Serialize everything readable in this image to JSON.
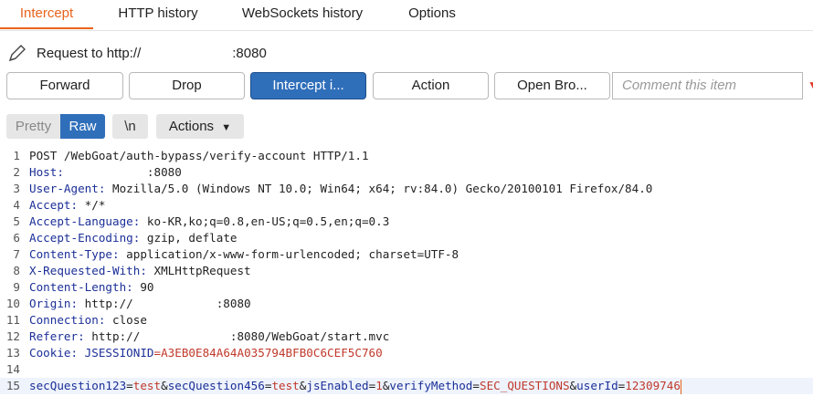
{
  "tabs": [
    "Intercept",
    "HTTP history",
    "WebSockets history",
    "Options"
  ],
  "request": {
    "prefix": "Request to http://",
    "suffix": ":8080"
  },
  "buttons": {
    "forward": "Forward",
    "drop": "Drop",
    "intercept": "Intercept i...",
    "action": "Action",
    "open_browser": "Open Bro..."
  },
  "comment_placeholder": "Comment this item",
  "view": {
    "pretty": "Pretty",
    "raw": "Raw",
    "newline": "\\n",
    "actions": "Actions"
  },
  "colors": {
    "accent": "#e8631c",
    "primary": "#2f6fba",
    "header_key": "#1b2f97",
    "value_red": "#c0392b"
  },
  "lines": [
    {
      "n": "1",
      "k": "",
      "v": "POST /WebGoat/auth-bypass/verify-account HTTP/1.1"
    },
    {
      "n": "2",
      "k": "Host:",
      "v": "            :8080"
    },
    {
      "n": "3",
      "k": "User-Agent:",
      "v": " Mozilla/5.0 (Windows NT 10.0; Win64; x64; rv:84.0) Gecko/20100101 Firefox/84.0"
    },
    {
      "n": "4",
      "k": "Accept:",
      "v": " */*"
    },
    {
      "n": "5",
      "k": "Accept-Language:",
      "v": " ko-KR,ko;q=0.8,en-US;q=0.5,en;q=0.3"
    },
    {
      "n": "6",
      "k": "Accept-Encoding:",
      "v": " gzip, deflate"
    },
    {
      "n": "7",
      "k": "Content-Type:",
      "v": " application/x-www-form-urlencoded; charset=UTF-8"
    },
    {
      "n": "8",
      "k": "X-Requested-With:",
      "v": " XMLHttpRequest"
    },
    {
      "n": "9",
      "k": "Content-Length:",
      "v": " 90"
    },
    {
      "n": "10",
      "k": "Origin:",
      "v": " http://            :8080"
    },
    {
      "n": "11",
      "k": "Connection:",
      "v": " close"
    },
    {
      "n": "12",
      "k": "Referer:",
      "v": " http://             :8080/WebGoat/start.mvc"
    },
    {
      "n": "13",
      "k": "Cookie:",
      "v": " ",
      "ck": "JSESSIONID",
      "cv": "=A3EB0E84A64A035794BFB0C6CEF5C760"
    },
    {
      "n": "14",
      "k": "",
      "v": ""
    },
    {
      "n": "15",
      "body": [
        {
          "t": "k",
          "s": "secQuestion123"
        },
        {
          "t": "p",
          "s": "="
        },
        {
          "t": "r",
          "s": "test"
        },
        {
          "t": "p",
          "s": "&"
        },
        {
          "t": "k",
          "s": "secQuestion456"
        },
        {
          "t": "p",
          "s": "="
        },
        {
          "t": "r",
          "s": "test"
        },
        {
          "t": "p",
          "s": "&"
        },
        {
          "t": "k",
          "s": "jsEnabled"
        },
        {
          "t": "p",
          "s": "="
        },
        {
          "t": "r",
          "s": "1"
        },
        {
          "t": "p",
          "s": "&"
        },
        {
          "t": "k",
          "s": "verifyMethod"
        },
        {
          "t": "p",
          "s": "="
        },
        {
          "t": "r",
          "s": "SEC_QUESTIONS"
        },
        {
          "t": "p",
          "s": "&"
        },
        {
          "t": "k",
          "s": "userId"
        },
        {
          "t": "p",
          "s": "="
        },
        {
          "t": "r",
          "s": "12309746"
        }
      ]
    }
  ]
}
